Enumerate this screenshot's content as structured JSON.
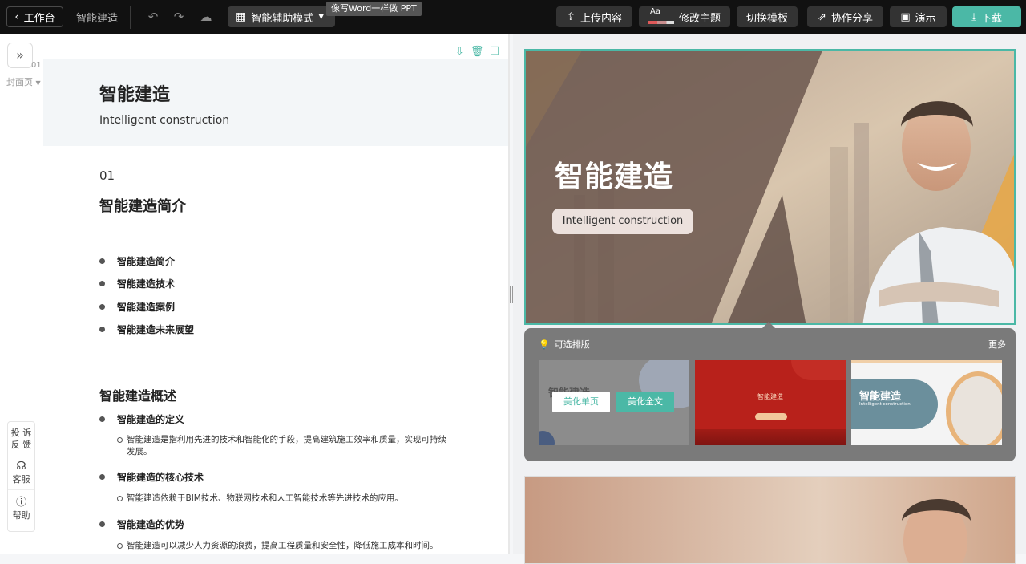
{
  "topbar": {
    "back_label": "工作台",
    "doc_name": "智能建造",
    "mode_label": "智能辅助模式",
    "tooltip": "像写Word一样做 PPT",
    "upload_label": "上传内容",
    "theme_badge": "Aa",
    "theme_label": "修改主题",
    "template_label": "切换模板",
    "share_label": "协作分享",
    "present_label": "演示",
    "download_label": "下载"
  },
  "outline": {
    "page_number": "01",
    "page_label": "封面页",
    "cover_title": "智能建造",
    "cover_subtitle": "Intelligent construction",
    "section_number": "01",
    "section_title": "智能建造简介",
    "toc": [
      "智能建造简介",
      "智能建造技术",
      "智能建造案例",
      "智能建造未来展望"
    ],
    "overview_title": "智能建造概述",
    "points": [
      {
        "title": "智能建造的定义",
        "detail": "智能建造是指利用先进的技术和智能化的手段，提高建筑施工效率和质量，实现可持续发展。"
      },
      {
        "title": "智能建造的核心技术",
        "detail": "智能建造依赖于BIM技术、物联网技术和人工智能技术等先进技术的应用。"
      },
      {
        "title": "智能建造的优势",
        "detail": "智能建造可以减少人力资源的浪费，提高工程质量和安全性，降低施工成本和时间。"
      }
    ]
  },
  "side_help": {
    "feedback_1": "投 诉",
    "feedback_2": "反 馈",
    "service": "客服",
    "help": "帮助"
  },
  "slide": {
    "title": "智能建造",
    "subtitle": "Intelligent construction"
  },
  "layout_panel": {
    "title": "可选排版",
    "more": "更多",
    "beautify_page": "美化单页",
    "beautify_all": "美化全文",
    "thumb1_title": "智能建造",
    "thumb2_title": "智能建造",
    "thumb3_title": "智能建造",
    "thumb3_sub": "Intelligent construction"
  },
  "colors": {
    "accent": "#4bb8a6",
    "topbar": "#111111"
  }
}
